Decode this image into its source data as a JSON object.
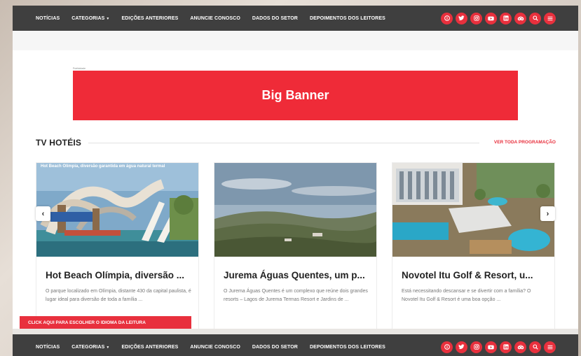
{
  "nav": {
    "items": [
      {
        "label": "NOTÍCIAS"
      },
      {
        "label": "CATEGORIAS",
        "caret": "▼"
      },
      {
        "label": "EDIÇÕES ANTERIORES"
      },
      {
        "label": "ANUNCIE CONOSCO"
      },
      {
        "label": "DADOS DO SETOR"
      },
      {
        "label": "DEPOIMENTOS DOS LEITORES"
      }
    ],
    "social_icons": [
      "info-icon",
      "twitter-icon",
      "instagram-icon",
      "youtube-icon",
      "linkedin-icon",
      "tripadvisor-icon",
      "search-icon",
      "menu-icon"
    ]
  },
  "ad": {
    "label": "Publicidade",
    "banner_text": "Big Banner"
  },
  "section": {
    "title": "TV HOTÉIS",
    "see_all": "VER TODA PROGRAMAÇÃO"
  },
  "cards": [
    {
      "overlay": "Hot Beach Olímpia, diversão garantida em água natural termal",
      "title": "Hot Beach Olímpia, diversão ...",
      "excerpt": "O parque localizado em Olímpia, distante 430 da capital paulista, é lugar ideal para diversão de toda a família ..."
    },
    {
      "title": "Jurema Águas Quentes, um p...",
      "excerpt": "O Jurema Águas Quentes é um complexo que reúne dois grandes resorts – Lagos de Jurema Termas Resort e Jardins de ..."
    },
    {
      "title": "Novotel Itu Golf & Resort, u...",
      "excerpt": "Está necessitando descansar e se divertir com a família? O Novotel Itu Golf & Resort é uma boa opção ..."
    }
  ],
  "carousel": {
    "prev": "‹",
    "next": "›"
  },
  "language_bar": "CLICK AQUI PARA ESCOLHER O IDIOMA DA LEITURA",
  "colors": {
    "accent": "#e8303d",
    "nav_bg": "#3f3f3f",
    "banner": "#ef2b38"
  }
}
